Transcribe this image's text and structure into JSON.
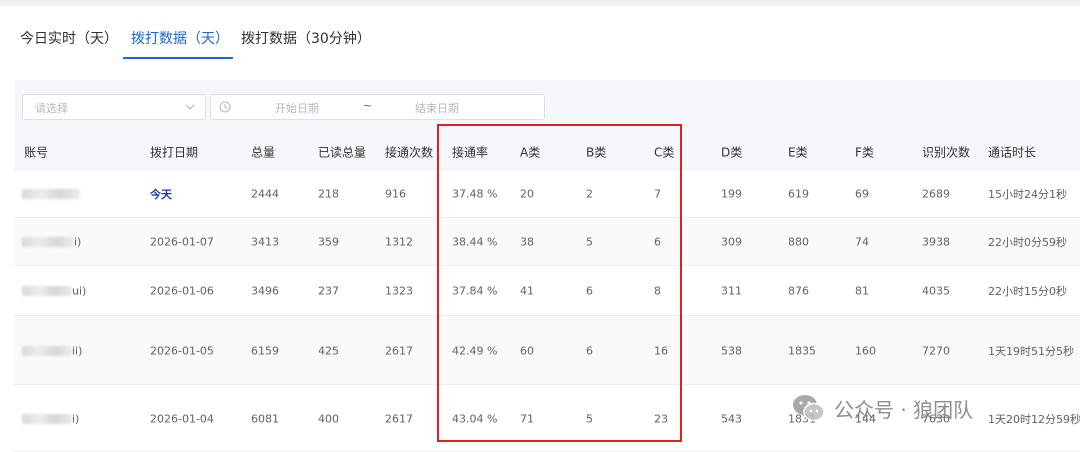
{
  "tabs": [
    {
      "label": "今日实时（天）",
      "active": false
    },
    {
      "label": "拨打数据（天）",
      "active": true
    },
    {
      "label": "拨打数据（30分钟）",
      "active": false
    }
  ],
  "filters": {
    "select_placeholder": "请选择",
    "date_start_placeholder": "开始日期",
    "date_separator": "~",
    "date_end_placeholder": "结束日期"
  },
  "table": {
    "columns": [
      "账号",
      "拨打日期",
      "总量",
      "已读总量",
      "接通次数",
      "接通率",
      "A类",
      "B类",
      "C类",
      "D类",
      "E类",
      "F类",
      "识别次数",
      "通话时长"
    ],
    "rows": [
      {
        "account_suffix": "",
        "cells": [
          "今天",
          "2444",
          "218",
          "916",
          "37.48 %",
          "20",
          "2",
          "7",
          "199",
          "619",
          "69",
          "2689",
          "15小时24分1秒"
        ]
      },
      {
        "account_suffix": "i)",
        "cells": [
          "2026-01-07",
          "3413",
          "359",
          "1312",
          "38.44 %",
          "38",
          "5",
          "6",
          "309",
          "880",
          "74",
          "3938",
          "22小时0分59秒"
        ]
      },
      {
        "account_suffix": "ui)",
        "cells": [
          "2026-01-06",
          "3496",
          "237",
          "1323",
          "37.84 %",
          "41",
          "6",
          "8",
          "311",
          "876",
          "81",
          "4035",
          "22小时15分0秒"
        ]
      },
      {
        "account_suffix": "ii)",
        "cells": [
          "2026-01-05",
          "6159",
          "425",
          "2617",
          "42.49 %",
          "60",
          "6",
          "16",
          "538",
          "1835",
          "160",
          "7270",
          "1天19时51分5秒"
        ]
      },
      {
        "account_suffix": "i)",
        "cells": [
          "2026-01-04",
          "6081",
          "400",
          "2617",
          "43.04 %",
          "71",
          "5",
          "23",
          "543",
          "1831",
          "144",
          "7630",
          "1天20时12分59秒"
        ]
      }
    ]
  },
  "watermark": {
    "text": "公众号 · 狼团队",
    "icon": "wechat-icon"
  },
  "colors": {
    "accent": "#1a66d6",
    "highlight": "#e02020",
    "today_link": "#1a3a9e"
  }
}
